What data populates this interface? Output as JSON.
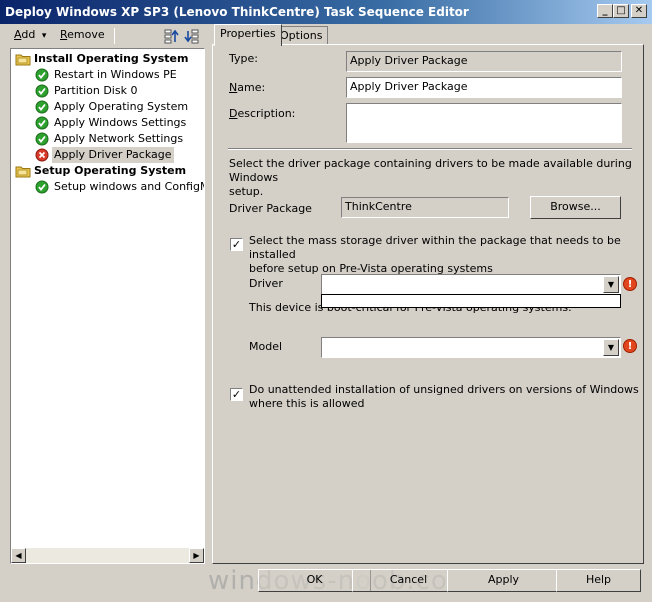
{
  "window": {
    "title": "Deploy Windows XP SP3 (Lenovo ThinkCentre) Task Sequence Editor",
    "minimize_glyph": "_",
    "maximize_glyph": "□",
    "close_glyph": "✕"
  },
  "toolbar": {
    "add_first": "A",
    "add_rest": "dd",
    "remove_first": "R",
    "remove_rest": "emove",
    "dropdown_glyph": "▾",
    "move_up_icon": "move-up-icon",
    "move_down_icon": "move-down-icon"
  },
  "tree": {
    "items": [
      {
        "label": "Install Operating System",
        "type": "group",
        "icon": "folder-icon"
      },
      {
        "label": "Restart in Windows PE",
        "type": "step",
        "icon": "check-icon"
      },
      {
        "label": "Partition Disk 0",
        "type": "step",
        "icon": "check-icon"
      },
      {
        "label": "Apply Operating System",
        "type": "step",
        "icon": "check-icon"
      },
      {
        "label": "Apply Windows Settings",
        "type": "step",
        "icon": "check-icon"
      },
      {
        "label": "Apply Network Settings",
        "type": "step",
        "icon": "check-icon"
      },
      {
        "label": "Apply Driver Package",
        "type": "step",
        "icon": "error-icon",
        "selected": true
      },
      {
        "label": "Setup Operating System",
        "type": "group",
        "icon": "folder-icon"
      },
      {
        "label": "Setup windows and ConfigMgr",
        "type": "step",
        "icon": "check-icon"
      }
    ],
    "scroll_left": "◀",
    "scroll_right": "▶"
  },
  "tabs": [
    {
      "label": "Properties",
      "active": true
    },
    {
      "label": "Options",
      "active": false
    }
  ],
  "properties": {
    "type_label": "Type:",
    "type_value": "Apply Driver Package",
    "name_label_first": "N",
    "name_label_rest": "ame:",
    "name_value": "Apply Driver Package",
    "description_label_first": "D",
    "description_label_rest": "escription:",
    "description_value": "",
    "instruction_line1": "Select the driver package containing drivers to be made available during Windows",
    "instruction_line2": "setup.",
    "driver_package_label": "Driver Package",
    "driver_package_value": "ThinkCentre",
    "browse_button": "Browse...",
    "mass_storage_checked": true,
    "mass_storage_line1": "Select the mass storage driver within the package that needs to be installed",
    "mass_storage_line2": "before setup on Pre-Vista operating systems",
    "driver_label": "Driver",
    "driver_value": "",
    "device_note": "This device is boot-critical for Pre-Vista operating systems.",
    "model_label": "Model",
    "model_value": "",
    "unsigned_checked": true,
    "unsigned_line1": "Do unattended installation of unsigned drivers on versions of Windows",
    "unsigned_line2": "where this is allowed",
    "check_glyph": "✓",
    "combo_arrow_glyph": "▼",
    "warn_glyph": "!"
  },
  "footer": {
    "ok": "OK",
    "cancel": "Cancel",
    "apply": "Apply",
    "help": "Help"
  },
  "watermark": "windows-noob.com",
  "colors": {
    "titlebar_start": "#0a246a",
    "check_green": "#2ea02e",
    "error_red": "#d83a2a",
    "folder_yellow": "#e8c44a"
  }
}
